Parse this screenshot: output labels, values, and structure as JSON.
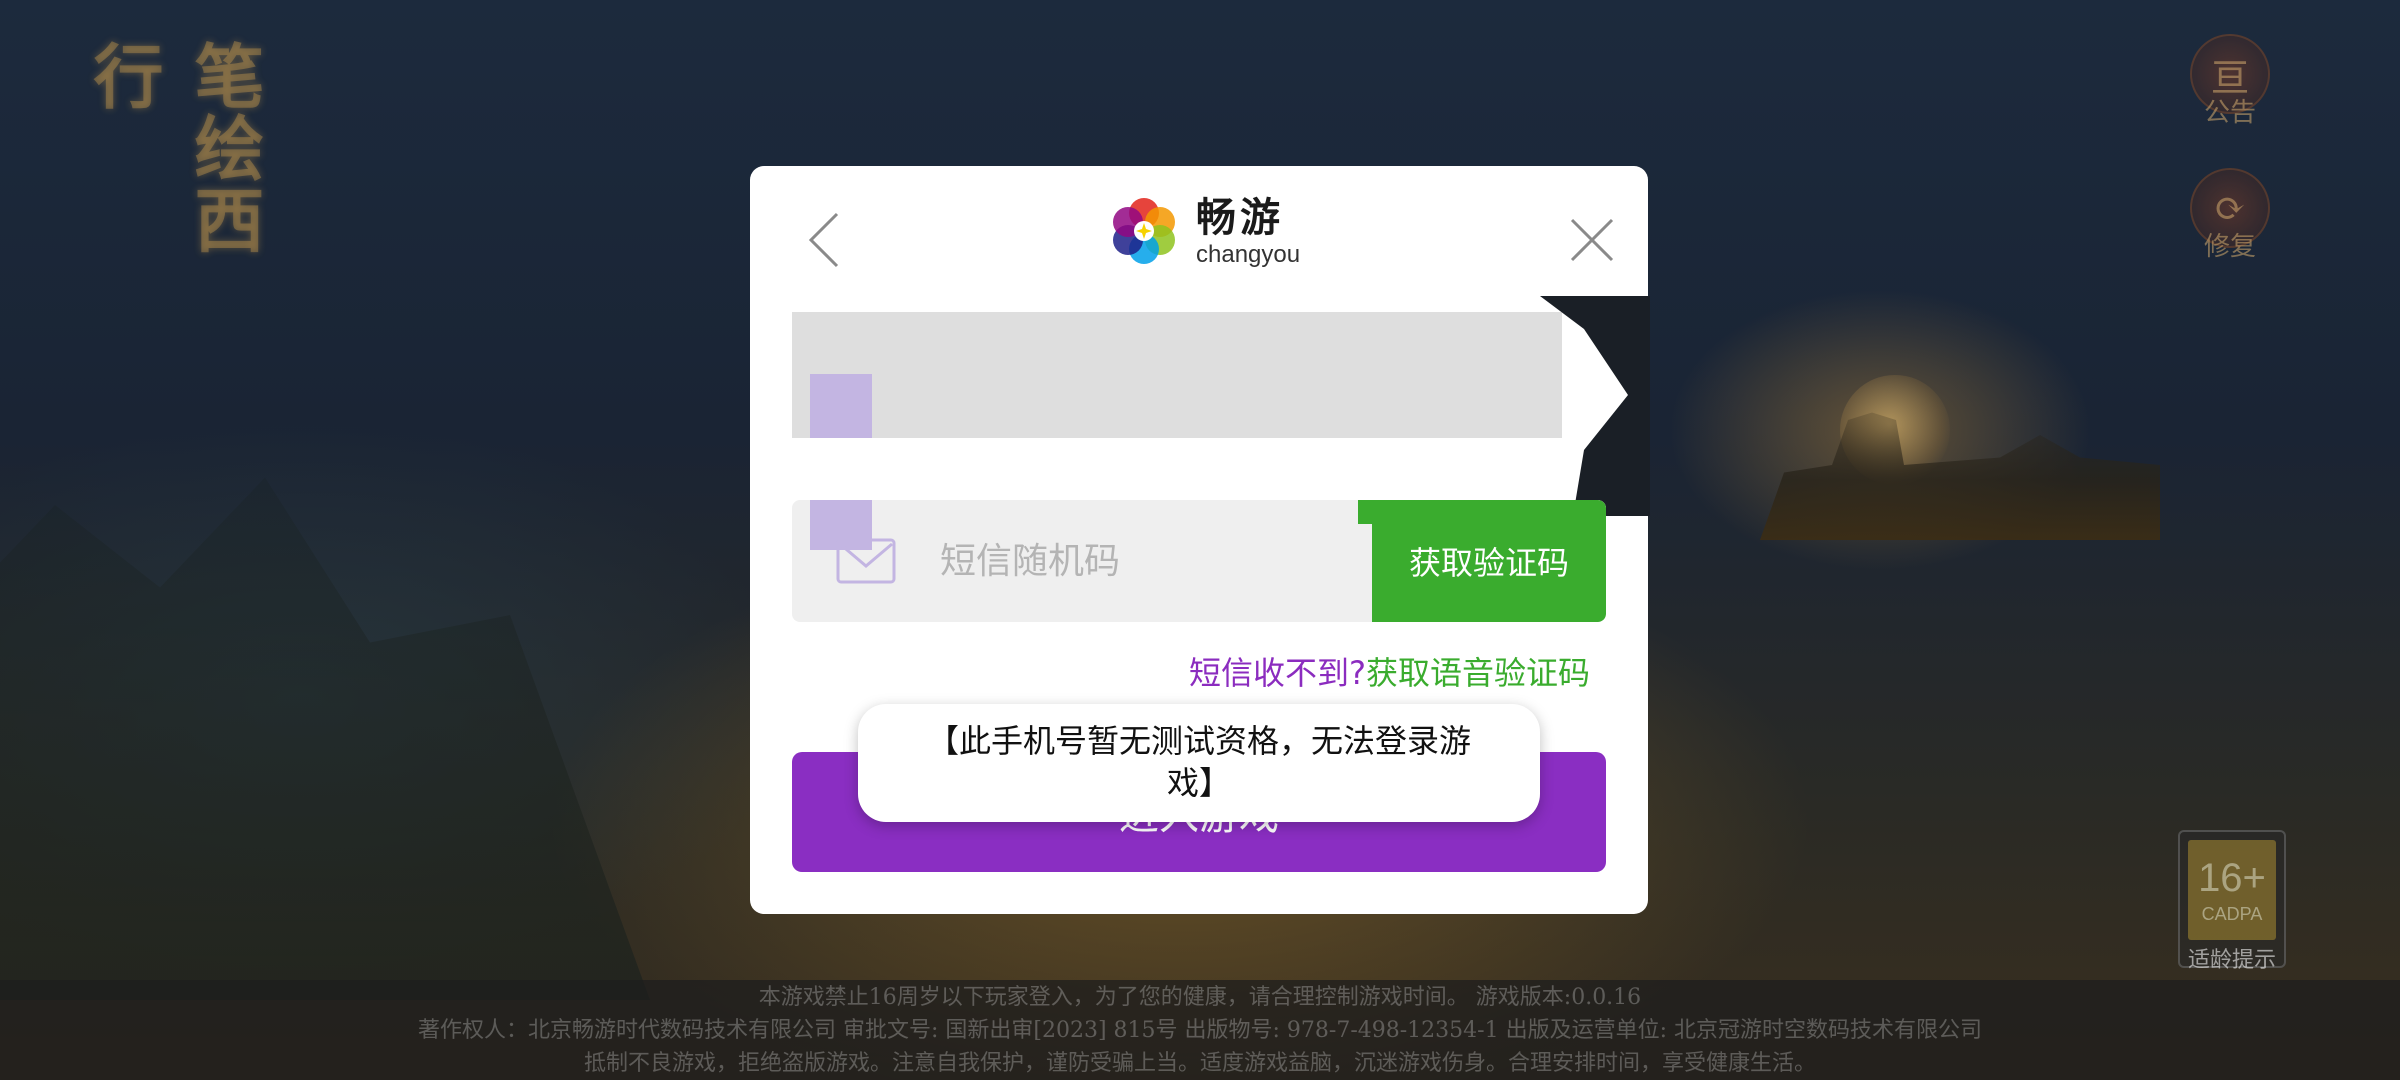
{
  "background": {
    "game_title": "笔绘西行"
  },
  "side_buttons": {
    "notice_label": "公告",
    "repair_label": "修复"
  },
  "age_badge": {
    "age": "16+",
    "org": "CADPA",
    "tip": "适龄提示"
  },
  "footer": {
    "line1": "本游戏禁止16周岁以下玩家登入，为了您的健康，请合理控制游戏时间。 游戏版本:0.0.16",
    "line2": "著作权人：北京畅游时代数码技术有限公司 审批文号: 国新出审[2023] 815号 出版物号: 978-7-498-12354-1 出版及运营单位: 北京冠游时空数码技术有限公司",
    "line3": "抵制不良游戏，拒绝盗版游戏。注意自我保护，谨防受骗上当。适度游戏益脑，沉迷游戏伤身。合理安排时间，享受健康生活。"
  },
  "dialog": {
    "logo_cn": "畅游",
    "logo_en": "changyou",
    "code_placeholder": "短信随机码",
    "get_code_label": "获取验证码",
    "voice_question": "短信收不到?",
    "voice_action": "获取语音验证码",
    "enter_label": "进入游戏"
  },
  "toast": {
    "message": "【此手机号暂无测试资格，无法登录游戏】"
  },
  "colors": {
    "brand_purple": "#8a2ec2",
    "brand_green": "#3aac2e"
  }
}
